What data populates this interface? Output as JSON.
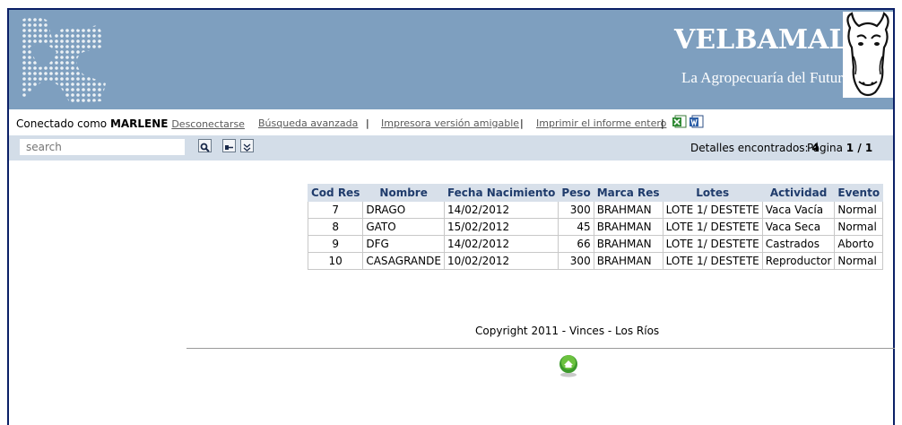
{
  "brand": {
    "title": "VELBAMAL",
    "subtitle": "La Agropecuaría del Futuro."
  },
  "session": {
    "prefix": "Conectado como",
    "user": "MARLENE",
    "logout": "Desconectarse"
  },
  "links": {
    "advanced_search": "Búsqueda avanzada",
    "printer_friendly": "Impresora versión amigable",
    "print_report": "Imprimir el informe entero",
    "separator": "|"
  },
  "search": {
    "placeholder": "search"
  },
  "results": {
    "found_label": "Detalles encontrados:",
    "found_count": "4",
    "page_label": "Página",
    "page_value": "1 / 1"
  },
  "table": {
    "headers": [
      "Cod Res",
      "Nombre",
      "Fecha Nacimiento",
      "Peso",
      "Marca Res",
      "Lotes",
      "Actividad",
      "Evento"
    ],
    "rows": [
      [
        "7",
        "DRAGO",
        "14/02/2012",
        "300",
        "BRAHMAN",
        "LOTE 1/ DESTETE",
        "Vaca Vacía",
        "Normal"
      ],
      [
        "8",
        "GATO",
        "15/02/2012",
        "45",
        "BRAHMAN",
        "LOTE 1/ DESTETE",
        "Vaca Seca",
        "Normal"
      ],
      [
        "9",
        "DFG",
        "14/02/2012",
        "66",
        "BRAHMAN",
        "LOTE 1/ DESTETE",
        "Castrados",
        "Aborto"
      ],
      [
        "10",
        "CASAGRANDE",
        "10/02/2012",
        "300",
        "BRAHMAN",
        "LOTE 1/ DESTETE",
        "Reproductor",
        "Normal"
      ]
    ]
  },
  "footer": {
    "copyright": "Copyright 2011 - Vinces - Los Ríos"
  },
  "colors": {
    "banner": "#7e9fbf",
    "toolbar": "#d3dde8",
    "header_bg": "#d8e0ea",
    "header_text": "#1f3b6b",
    "frame": "#0b1f66"
  },
  "icons": {
    "logo": "dot-pattern-logo",
    "mascot": "cow-head-logo",
    "excel": "excel-export-icon",
    "word": "word-export-icon",
    "search_button": "magnifier-icon",
    "show_options": "options-icon",
    "expand": "double-chevron-down-icon",
    "home": "home-icon"
  }
}
